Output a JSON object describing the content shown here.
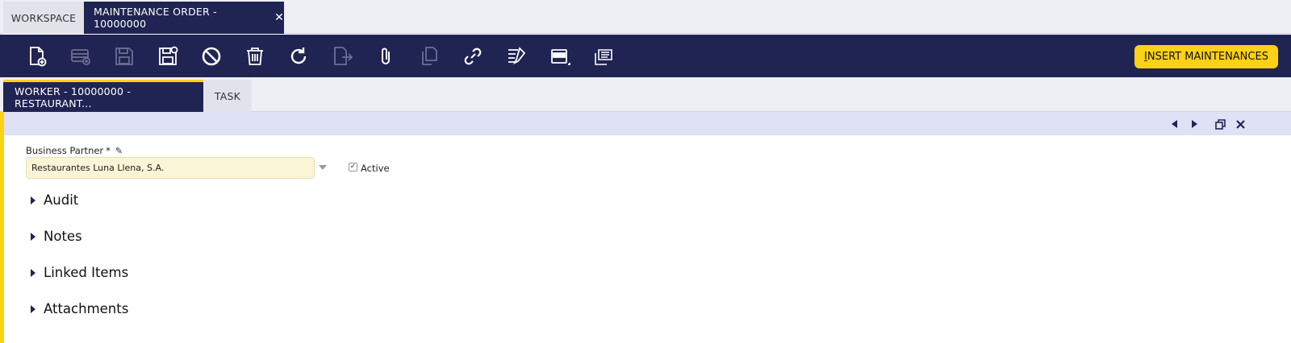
{
  "top_tabs": {
    "workspace": "WORKSPACE",
    "active": "MAINTENANCE ORDER - 10000000",
    "close": "✕"
  },
  "toolbar": {
    "icons": [
      "new-document-icon",
      "new-row-icon",
      "save-icon",
      "save-close-icon",
      "cancel-icon",
      "delete-icon",
      "refresh-icon",
      "export-icon",
      "attachment-icon",
      "clone-icon",
      "link-icon",
      "tools-icon",
      "form-view-icon",
      "report-icon"
    ],
    "insert_letter": "I",
    "insert_rest": "NSERT MAINTENANCES"
  },
  "sub_tabs": {
    "active": "WORKER - 10000000 - RESTAURANT...",
    "task": "TASK"
  },
  "form": {
    "bp_label": "Business Partner",
    "bp_required": "*",
    "bp_value": "Restaurantes Luna Llena, S.A.",
    "active_label": "Active",
    "active_checked": true
  },
  "sections": [
    "Audit",
    "Notes",
    "Linked Items",
    "Attachments"
  ],
  "colors": {
    "navy": "#202452",
    "yellow": "#fcd116",
    "field_bg": "#faf5d7",
    "status_bar": "#dfe1f5"
  }
}
